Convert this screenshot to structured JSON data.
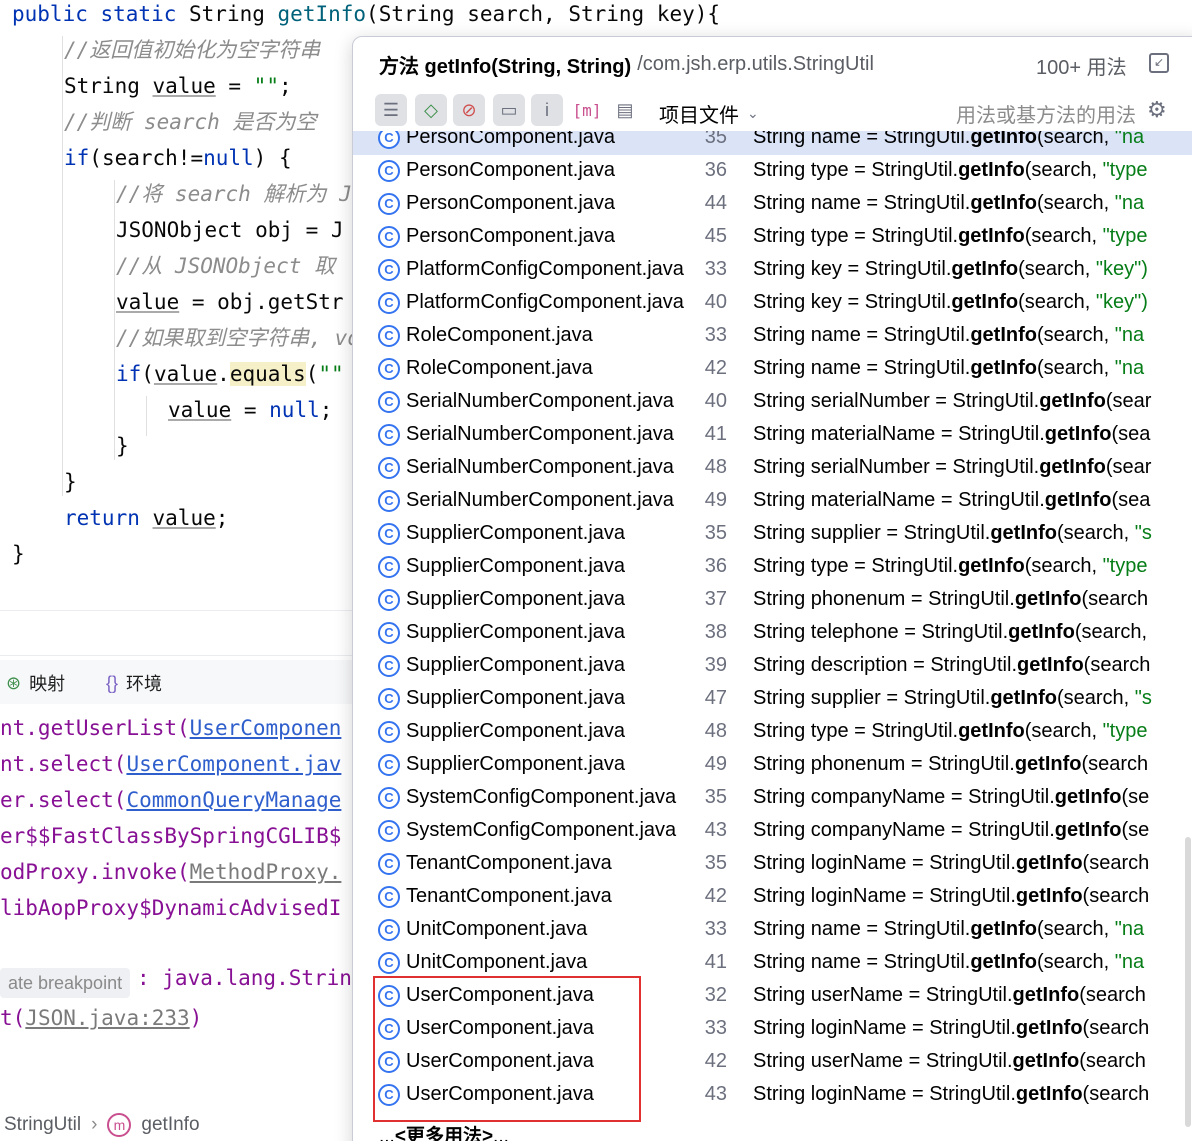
{
  "editor": {
    "lines": [
      {
        "parts": [
          [
            "kw",
            "public static "
          ],
          [
            "",
            "String "
          ],
          [
            "fn",
            "getInfo"
          ],
          [
            "",
            "(String search, String key){"
          ]
        ]
      },
      {
        "parts": [
          [
            "cm",
            "//返回值初始化为空字符串"
          ]
        ]
      },
      {
        "parts": [
          [
            "",
            "String "
          ],
          [
            "var",
            "value"
          ],
          [
            "",
            " = "
          ],
          [
            "str",
            "\"\""
          ],
          [
            "",
            ";"
          ]
        ]
      },
      {
        "parts": [
          [
            "cm",
            "//判断 search 是否为空"
          ]
        ]
      },
      {
        "parts": [
          [
            "kw",
            "if"
          ],
          [
            "",
            "(search!="
          ],
          [
            "kw",
            "null"
          ],
          [
            "",
            ") {"
          ]
        ]
      },
      {
        "parts": [
          [
            "cm",
            "//将 search 解析为 J"
          ]
        ]
      },
      {
        "parts": [
          [
            "",
            "JSONObject obj = J"
          ]
        ]
      },
      {
        "parts": [
          [
            "cm",
            "//从 JSONObject 取"
          ]
        ]
      },
      {
        "parts": [
          [
            "var",
            "value"
          ],
          [
            "",
            " = obj.getStr"
          ]
        ]
      },
      {
        "parts": [
          [
            "cm",
            "//如果取到空字符串, vo"
          ]
        ]
      },
      {
        "parts": [
          [
            "kw",
            "if"
          ],
          [
            "",
            "("
          ],
          [
            "var",
            "value"
          ],
          [
            "",
            "."
          ],
          [
            "hl",
            "equals"
          ],
          [
            "",
            "("
          ],
          [
            "str",
            "\"\""
          ]
        ]
      },
      {
        "parts": [
          [
            "var",
            "value"
          ],
          [
            "",
            " = "
          ],
          [
            "kw",
            "null"
          ],
          [
            "",
            ";"
          ]
        ]
      },
      {
        "parts": [
          [
            "",
            "}"
          ]
        ]
      },
      {
        "parts": [
          [
            "",
            "}"
          ]
        ]
      },
      {
        "parts": [
          [
            "kw",
            "return "
          ],
          [
            "var",
            "value"
          ],
          [
            "",
            ";"
          ]
        ]
      },
      {
        "parts": [
          [
            "",
            "}"
          ]
        ]
      }
    ]
  },
  "debug_tabs": {
    "mapping": {
      "icon": "mapping-icon",
      "label": "映射"
    },
    "env": {
      "icon": "braces-icon",
      "label": "环境"
    }
  },
  "stack": [
    {
      "prefix": "nt.getUserList(",
      "link": "UserComponen",
      "grey": false
    },
    {
      "prefix": "nt.select(",
      "link": "UserComponent.jav",
      "grey": false
    },
    {
      "prefix": "er.select(",
      "link": "CommonQueryManage",
      "grey": false
    },
    {
      "prefix": "er$$FastClassBySpringCGLIB$",
      "link": "",
      "grey": false
    },
    {
      "prefix": "odProxy.invoke(",
      "link": "MethodProxy.",
      "grey": true
    },
    {
      "prefix": "libAopProxy$DynamicAdvisedI",
      "link": "",
      "grey": false
    }
  ],
  "breakpoint": {
    "badge": "ate breakpoint",
    "rest": ": java.lang.Strin",
    "last_prefix": "t(",
    "last_link": "JSON.java:233",
    "last_suffix": ")"
  },
  "breadcrumb": {
    "class": "StringUtil",
    "method_icon": "method-icon",
    "method": "getInfo"
  },
  "popup": {
    "title": "方法 getInfo(String, String)",
    "path": "/com.jsh.erp.utils.StringUtil",
    "count": "100+ 用法",
    "pin_icon": "pin-icon",
    "toolbar": {
      "scope": "项目文件",
      "hint": "用法或基方法的用法",
      "buttons": [
        "merge-lines-icon",
        "navigate-icon",
        "exclude-icon",
        "module-icon",
        "info-icon",
        "method-filter-icon",
        "file-icon"
      ],
      "gear_icon": "gear-icon"
    },
    "rows": [
      {
        "file": "PersonComponent.java",
        "line": "35",
        "pre": "String name = StringUtil.",
        "fn": "getInfo",
        "post": "(search, ",
        "s": "\"na",
        "selected": true
      },
      {
        "file": "PersonComponent.java",
        "line": "36",
        "pre": "String type = StringUtil.",
        "fn": "getInfo",
        "post": "(search, ",
        "s": "\"type",
        "selected": false
      },
      {
        "file": "PersonComponent.java",
        "line": "44",
        "pre": "String name = StringUtil.",
        "fn": "getInfo",
        "post": "(search, ",
        "s": "\"na",
        "selected": false
      },
      {
        "file": "PersonComponent.java",
        "line": "45",
        "pre": "String type = StringUtil.",
        "fn": "getInfo",
        "post": "(search, ",
        "s": "\"type",
        "selected": false
      },
      {
        "file": "PlatformConfigComponent.java",
        "line": "33",
        "pre": "String key = StringUtil.",
        "fn": "getInfo",
        "post": "(search, ",
        "s": "\"key\")",
        "selected": false
      },
      {
        "file": "PlatformConfigComponent.java",
        "line": "40",
        "pre": "String key = StringUtil.",
        "fn": "getInfo",
        "post": "(search, ",
        "s": "\"key\")",
        "selected": false
      },
      {
        "file": "RoleComponent.java",
        "line": "33",
        "pre": "String name = StringUtil.",
        "fn": "getInfo",
        "post": "(search, ",
        "s": "\"na",
        "selected": false
      },
      {
        "file": "RoleComponent.java",
        "line": "42",
        "pre": "String name = StringUtil.",
        "fn": "getInfo",
        "post": "(search, ",
        "s": "\"na",
        "selected": false
      },
      {
        "file": "SerialNumberComponent.java",
        "line": "40",
        "pre": "String serialNumber = StringUtil.",
        "fn": "getInfo",
        "post": "(sear",
        "s": "",
        "selected": false
      },
      {
        "file": "SerialNumberComponent.java",
        "line": "41",
        "pre": "String materialName = StringUtil.",
        "fn": "getInfo",
        "post": "(sea",
        "s": "",
        "selected": false
      },
      {
        "file": "SerialNumberComponent.java",
        "line": "48",
        "pre": "String serialNumber = StringUtil.",
        "fn": "getInfo",
        "post": "(sear",
        "s": "",
        "selected": false
      },
      {
        "file": "SerialNumberComponent.java",
        "line": "49",
        "pre": "String materialName = StringUtil.",
        "fn": "getInfo",
        "post": "(sea",
        "s": "",
        "selected": false
      },
      {
        "file": "SupplierComponent.java",
        "line": "35",
        "pre": "String supplier = StringUtil.",
        "fn": "getInfo",
        "post": "(search, ",
        "s": "\"s",
        "selected": false
      },
      {
        "file": "SupplierComponent.java",
        "line": "36",
        "pre": "String type = StringUtil.",
        "fn": "getInfo",
        "post": "(search, ",
        "s": "\"type",
        "selected": false
      },
      {
        "file": "SupplierComponent.java",
        "line": "37",
        "pre": "String phonenum = StringUtil.",
        "fn": "getInfo",
        "post": "(search",
        "s": "",
        "selected": false
      },
      {
        "file": "SupplierComponent.java",
        "line": "38",
        "pre": "String telephone = StringUtil.",
        "fn": "getInfo",
        "post": "(search,",
        "s": "",
        "selected": false
      },
      {
        "file": "SupplierComponent.java",
        "line": "39",
        "pre": "String description = StringUtil.",
        "fn": "getInfo",
        "post": "(search",
        "s": "",
        "selected": false
      },
      {
        "file": "SupplierComponent.java",
        "line": "47",
        "pre": "String supplier = StringUtil.",
        "fn": "getInfo",
        "post": "(search, ",
        "s": "\"s",
        "selected": false
      },
      {
        "file": "SupplierComponent.java",
        "line": "48",
        "pre": "String type = StringUtil.",
        "fn": "getInfo",
        "post": "(search, ",
        "s": "\"type",
        "selected": false
      },
      {
        "file": "SupplierComponent.java",
        "line": "49",
        "pre": "String phonenum = StringUtil.",
        "fn": "getInfo",
        "post": "(search",
        "s": "",
        "selected": false
      },
      {
        "file": "SystemConfigComponent.java",
        "line": "35",
        "pre": "String companyName = StringUtil.",
        "fn": "getInfo",
        "post": "(se",
        "s": "",
        "selected": false
      },
      {
        "file": "SystemConfigComponent.java",
        "line": "43",
        "pre": "String companyName = StringUtil.",
        "fn": "getInfo",
        "post": "(se",
        "s": "",
        "selected": false
      },
      {
        "file": "TenantComponent.java",
        "line": "35",
        "pre": "String loginName = StringUtil.",
        "fn": "getInfo",
        "post": "(search",
        "s": "",
        "selected": false
      },
      {
        "file": "TenantComponent.java",
        "line": "42",
        "pre": "String loginName = StringUtil.",
        "fn": "getInfo",
        "post": "(search",
        "s": "",
        "selected": false
      },
      {
        "file": "UnitComponent.java",
        "line": "33",
        "pre": "String name = StringUtil.",
        "fn": "getInfo",
        "post": "(search, ",
        "s": "\"na",
        "selected": false
      },
      {
        "file": "UnitComponent.java",
        "line": "41",
        "pre": "String name = StringUtil.",
        "fn": "getInfo",
        "post": "(search, ",
        "s": "\"na",
        "selected": false
      },
      {
        "file": "UserComponent.java",
        "line": "32",
        "pre": "String userName = StringUtil.",
        "fn": "getInfo",
        "post": "(search",
        "s": "",
        "selected": false
      },
      {
        "file": "UserComponent.java",
        "line": "33",
        "pre": "String loginName = StringUtil.",
        "fn": "getInfo",
        "post": "(search",
        "s": "",
        "selected": false
      },
      {
        "file": "UserComponent.java",
        "line": "42",
        "pre": "String userName = StringUtil.",
        "fn": "getInfo",
        "post": "(search",
        "s": "",
        "selected": false
      },
      {
        "file": "UserComponent.java",
        "line": "43",
        "pre": "String loginName = StringUtil.",
        "fn": "getInfo",
        "post": "(search",
        "s": "",
        "selected": false
      }
    ],
    "more_prefix": "...",
    "more_label": "<更多用法>",
    "more_suffix": "..."
  }
}
